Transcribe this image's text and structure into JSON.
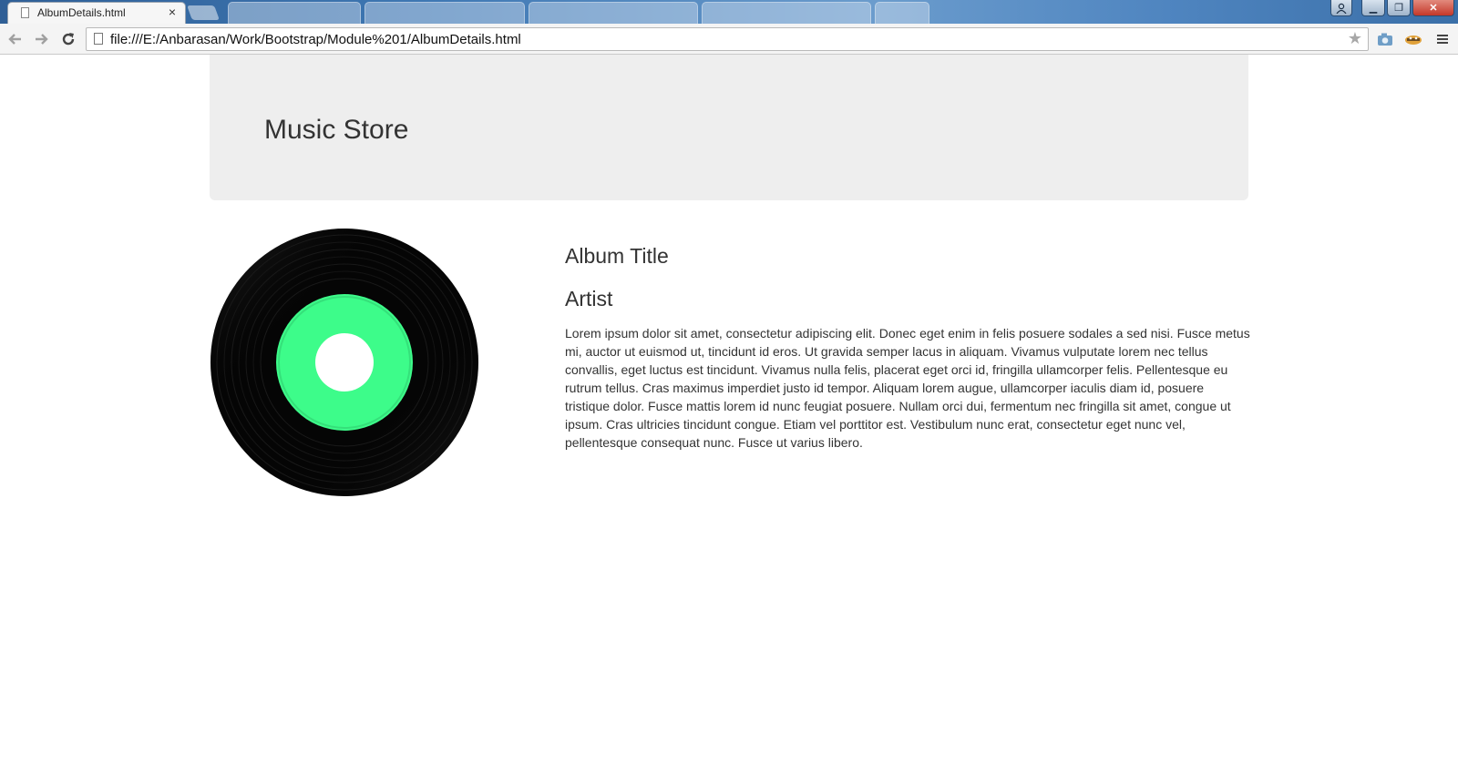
{
  "browser": {
    "active_tab_title": "AlbumDetails.html",
    "tab_close_glyph": "×",
    "background_tabs": [
      "",
      "",
      "",
      "",
      ""
    ],
    "url": "file:///E:/Anbarasan/Work/Bootstrap/Module%201/AlbumDetails.html",
    "icons": {
      "back": "back-arrow-icon",
      "forward": "forward-arrow-icon",
      "reload": "reload-icon",
      "bookmark": "star-icon",
      "camera": "camera-icon",
      "extension": "extension-icon",
      "menu": "menu-icon"
    },
    "window_buttons": {
      "minimize": "▁",
      "maximize": "❐",
      "close": "✕"
    }
  },
  "page": {
    "jumbotron_title": "Music Store",
    "album": {
      "title": "Album Title",
      "artist": "Artist",
      "description": "Lorem ipsum dolor sit amet, consectetur adipiscing elit. Donec eget enim in felis posuere sodales a sed nisi. Fusce metus mi, auctor ut euismod ut, tincidunt id eros. Ut gravida semper lacus in aliquam. Vivamus vulputate lorem nec tellus convallis, eget luctus est tincidunt. Vivamus nulla felis, placerat eget orci id, fringilla ullamcorper felis. Pellentesque eu rutrum tellus. Cras maximus imperdiet justo id tempor. Aliquam lorem augue, ullamcorper iaculis diam id, posuere tristique dolor. Fusce mattis lorem id nunc feugiat posuere. Nullam orci dui, fermentum nec fringilla sit amet, congue ut ipsum. Cras ultricies tincidunt congue. Etiam vel porttitor est. Vestibulum nunc erat, consectetur eget nunc vel, pellentesque consequat nunc. Fusce ut varius libero."
    },
    "colors": {
      "jumbotron_bg": "#eeeeee",
      "record_label": "#3dfc8a",
      "record_vinyl": "#050505"
    }
  }
}
